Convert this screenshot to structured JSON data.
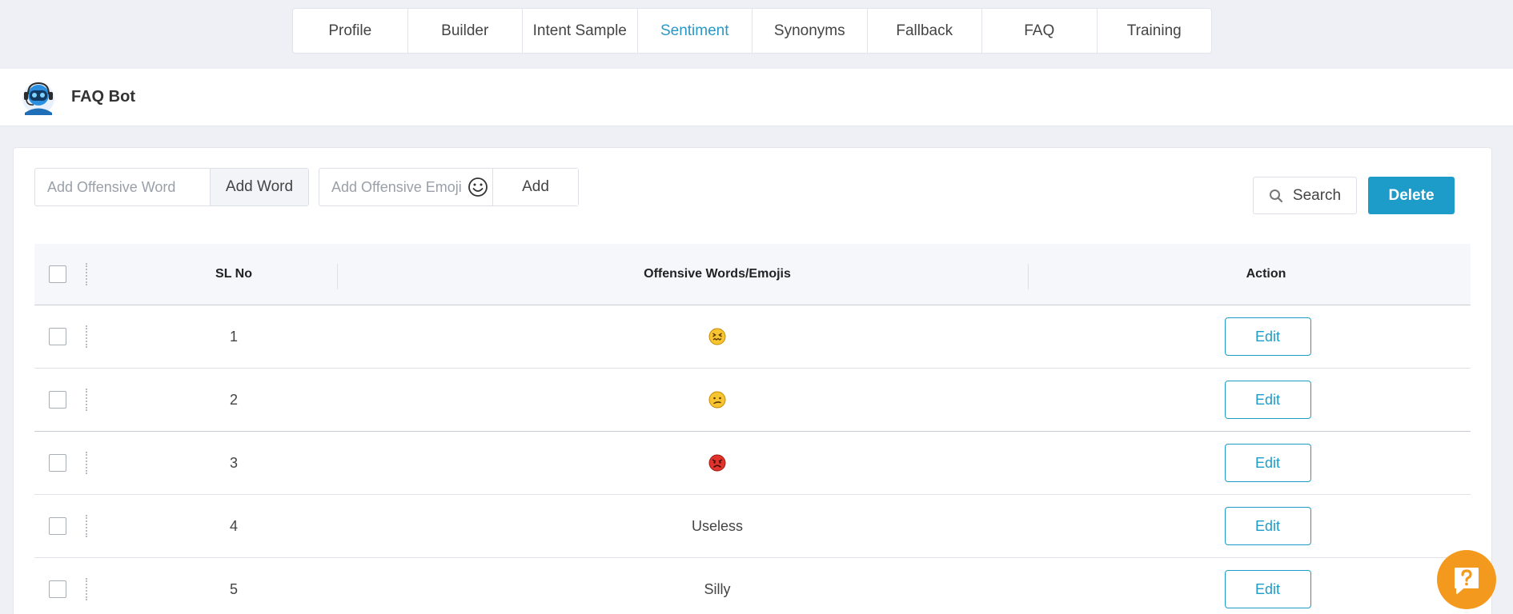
{
  "tabs": [
    {
      "label": "Profile"
    },
    {
      "label": "Builder"
    },
    {
      "label": "Intent Sample"
    },
    {
      "label": "Sentiment",
      "active": true
    },
    {
      "label": "Synonyms"
    },
    {
      "label": "Fallback"
    },
    {
      "label": "FAQ"
    },
    {
      "label": "Training"
    }
  ],
  "bot": {
    "name": "FAQ Bot",
    "avatar_icon": "robot-headset-icon"
  },
  "toolbar": {
    "word_placeholder": "Add Offensive Word",
    "add_word_label": "Add Word",
    "emoji_placeholder": "Add Offensive Emoji",
    "emoji_picker_icon": "smiley-icon",
    "add_label": "Add",
    "search_label": "Search",
    "delete_label": "Delete"
  },
  "table": {
    "headers": {
      "sl_no": "SL No",
      "words": "Offensive Words/Emojis",
      "action": "Action"
    },
    "rows": [
      {
        "sl": "1",
        "type": "emoji",
        "emoji": "confounded-face-icon",
        "text": ""
      },
      {
        "sl": "2",
        "type": "emoji",
        "emoji": "confused-face-icon",
        "text": ""
      },
      {
        "sl": "3",
        "type": "emoji",
        "emoji": "angry-face-icon",
        "text": ""
      },
      {
        "sl": "4",
        "type": "text",
        "text": "Useless"
      },
      {
        "sl": "5",
        "type": "text",
        "text": "Silly"
      }
    ],
    "edit_label": "Edit"
  },
  "help_widget": {
    "icon": "question-mark-icon"
  },
  "colors": {
    "accent": "#1e9cc9",
    "active_tab": "#2b97c6",
    "help_widget": "#f39a1e",
    "angry_emoji": "#e0332b",
    "face_emoji": "#f7c531"
  }
}
